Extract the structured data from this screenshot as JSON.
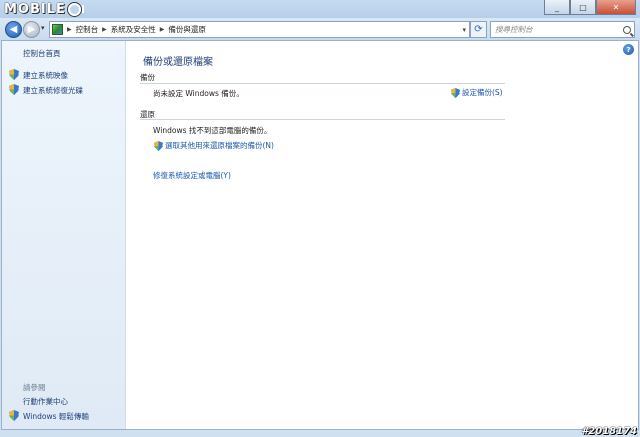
{
  "watermark_logo": "MOBILE01",
  "window": {
    "minimize_icon": "minimize-icon",
    "maximize_icon": "maximize-icon",
    "close_icon": "close-icon"
  },
  "nav": {
    "breadcrumb": [
      "控制台",
      "系統及安全性",
      "備份與還原"
    ],
    "search_placeholder": "搜尋控制台"
  },
  "sidebar": {
    "home_label": "控制台首頁",
    "items": [
      {
        "label": "建立系統映像",
        "icon": "uac-shield-icon"
      },
      {
        "label": "建立系統修復光碟",
        "icon": "uac-shield-icon"
      }
    ],
    "see_also_heading": "請參閱",
    "see_also": [
      {
        "label": "行動作業中心",
        "icon": ""
      },
      {
        "label": "Windows 輕鬆傳輸",
        "icon": "uac-shield-icon"
      }
    ]
  },
  "main": {
    "title": "備份或還原檔案",
    "backup_section": {
      "heading": "備份",
      "status": "尚未設定 Windows 備份。",
      "setup_link": "設定備份(S)"
    },
    "restore_section": {
      "heading": "還原",
      "status": "Windows 找不到這部電腦的備份。",
      "select_link": "選取其他用來還原檔案的備份(N)",
      "recover_link": "修復系統設定或電腦(Y)"
    }
  },
  "watermark_id": "#2018174",
  "colors": {
    "link": "#1a56b0",
    "sidebar_link": "#1e3f76",
    "title": "#1e3f76"
  }
}
